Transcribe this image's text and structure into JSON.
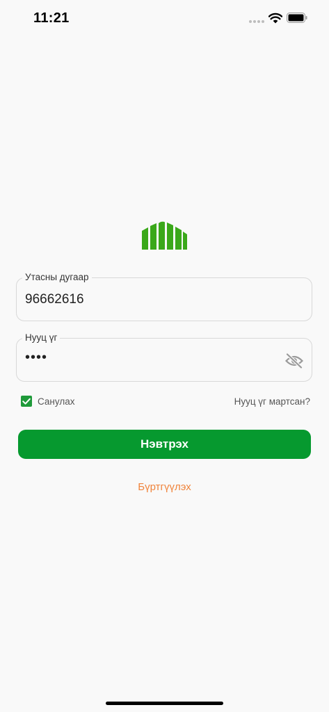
{
  "status_bar": {
    "time": "11:21",
    "icons": [
      "cellular-signal-icon",
      "wifi-icon",
      "battery-icon"
    ]
  },
  "logo": {
    "icon": "building-logo-icon",
    "color": "#3aa81a"
  },
  "phone_field": {
    "label": "Утасны дугаар",
    "value": "96662616"
  },
  "password_field": {
    "label": "Нууц үг",
    "value": "••••",
    "visibility_icon": "eye-off-icon"
  },
  "remember": {
    "label": "Санулах",
    "checked": true
  },
  "forgot_password": "Нууц үг мартсан?",
  "login_button": "Нэвтрэх",
  "register_link": "Бүртгүүлэх",
  "colors": {
    "primary": "#06992f",
    "accent_link": "#f0843c",
    "background": "#f9f9f9"
  }
}
